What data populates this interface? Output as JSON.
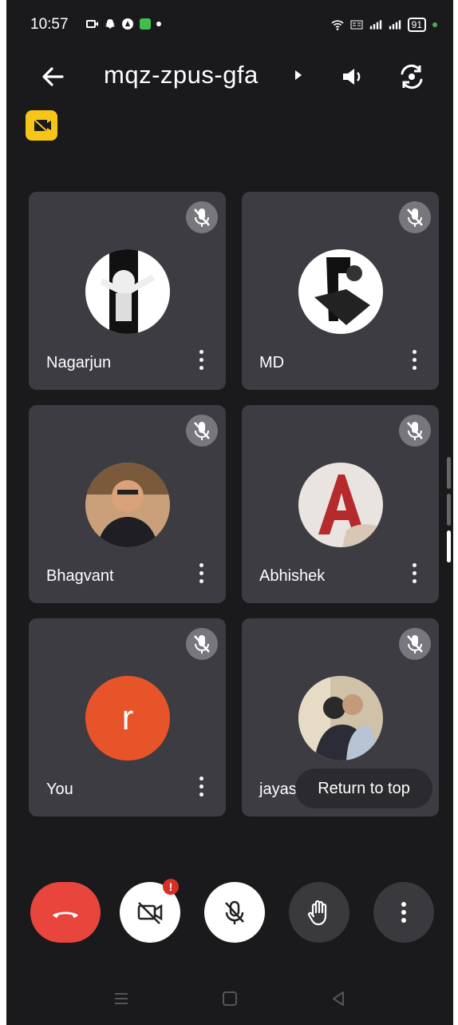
{
  "status_bar": {
    "time": "10:57",
    "battery": "91"
  },
  "meeting": {
    "code": "mqz-zpus-gfa"
  },
  "participants": [
    {
      "name": "Nagarjun",
      "muted": true
    },
    {
      "name": "MD",
      "muted": true
    },
    {
      "name": "Bhagvant",
      "muted": true
    },
    {
      "name": "Abhishek",
      "muted": true
    },
    {
      "name": "You",
      "initial": "r",
      "muted": true,
      "avatar_color": "#e8542a"
    },
    {
      "name": "jayas",
      "muted": true
    }
  ],
  "return_to_top": "Return to top",
  "camera_notification": "!",
  "colors": {
    "end_call": "#e8453c",
    "tile": "#3c3c42",
    "background": "#1a1a1c",
    "badge": "#f5c518"
  }
}
